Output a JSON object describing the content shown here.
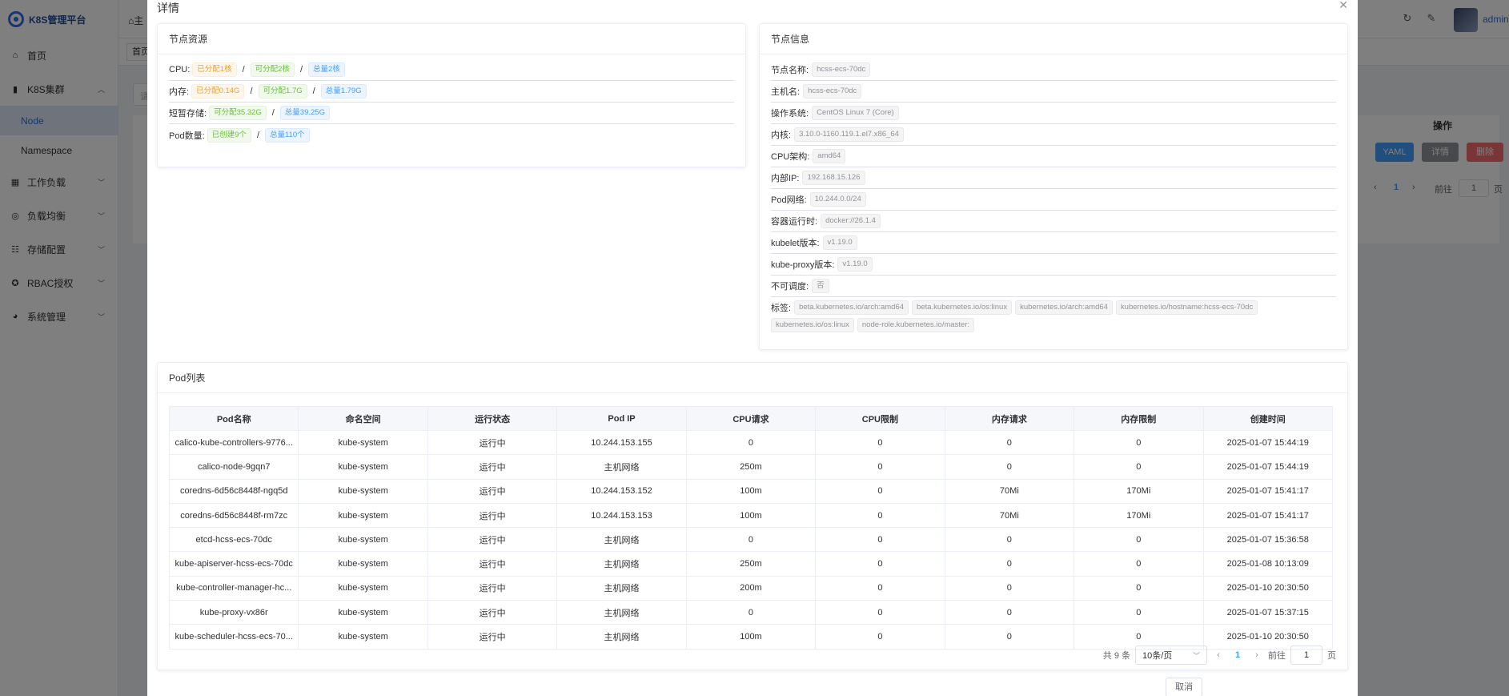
{
  "app": {
    "title": "K8S管理平台",
    "user": "admin"
  },
  "sidebar": {
    "items": [
      {
        "label": "首页",
        "icon": "home-icon"
      },
      {
        "label": "K8S集群",
        "icon": "chart-icon"
      },
      {
        "label": "工作负载",
        "icon": "grid-icon"
      },
      {
        "label": "负载均衡",
        "icon": "balance-icon"
      },
      {
        "label": "存储配置",
        "icon": "list-icon"
      },
      {
        "label": "RBAC授权",
        "icon": "gear-icon"
      },
      {
        "label": "系统管理",
        "icon": "dashboard-icon"
      }
    ],
    "sub_items": [
      {
        "label": "Node"
      },
      {
        "label": "Namespace"
      }
    ]
  },
  "topbar": {
    "breadcrumb": "主",
    "tab_home": "首页"
  },
  "background": {
    "search_placeholder": "请",
    "op_header": "操作",
    "yaml_btn": "YAML",
    "detail_btn": "详情",
    "delete_btn": "删除",
    "pager_current": "1",
    "pager_goto": "前往",
    "pager_input": "1",
    "pager_page": "页"
  },
  "dialog": {
    "title": "详情",
    "resource": {
      "title": "节点资源",
      "cpu_label": "CPU:",
      "cpu_allocated": "已分配1核",
      "cpu_allocatable": "可分配2核",
      "cpu_total": "总量2核",
      "mem_label": "内存:",
      "mem_allocated": "已分配0.14G",
      "mem_allocatable": "可分配1.7G",
      "mem_total": "总量1.79G",
      "storage_label": "短暂存储:",
      "storage_allocatable": "可分配35.32G",
      "storage_total": "总量39.25G",
      "pod_label": "Pod数量:",
      "pod_created": "已创建9个",
      "pod_total": "总量110个",
      "sep": "/"
    },
    "node_info": {
      "title": "节点信息",
      "rows": [
        {
          "label": "节点名称:",
          "value": "hcss-ecs-70dc"
        },
        {
          "label": "主机名:",
          "value": "hcss-ecs-70dc"
        },
        {
          "label": "操作系统:",
          "value": "CentOS Linux 7 (Core)"
        },
        {
          "label": "内核:",
          "value": "3.10.0-1160.119.1.el7.x86_64"
        },
        {
          "label": "CPU架构:",
          "value": "amd64"
        },
        {
          "label": "内部IP:",
          "value": "192.168.15.126"
        },
        {
          "label": "Pod网络:",
          "value": "10.244.0.0/24"
        },
        {
          "label": "容器运行时:",
          "value": "docker://26.1.4"
        },
        {
          "label": "kubelet版本:",
          "value": "v1.19.0"
        },
        {
          "label": "kube-proxy版本:",
          "value": "v1.19.0"
        },
        {
          "label": "不可调度:",
          "value": "否"
        }
      ],
      "labels_label": "标签:",
      "labels": [
        "beta.kubernetes.io/arch:amd64",
        "beta.kubernetes.io/os:linux",
        "kubernetes.io/arch:amd64",
        "kubernetes.io/hostname:hcss-ecs-70dc",
        "kubernetes.io/os:linux",
        "node-role.kubernetes.io/master:"
      ]
    },
    "pods": {
      "title": "Pod列表",
      "columns": [
        "Pod名称",
        "命名空间",
        "运行状态",
        "Pod IP",
        "CPU请求",
        "CPU限制",
        "内存请求",
        "内存限制",
        "创建时间"
      ],
      "rows": [
        [
          "calico-kube-controllers-9776...",
          "kube-system",
          "运行中",
          "10.244.153.155",
          "0",
          "0",
          "0",
          "0",
          "2025-01-07 15:44:19"
        ],
        [
          "calico-node-9gqn7",
          "kube-system",
          "运行中",
          "主机网络",
          "250m",
          "0",
          "0",
          "0",
          "2025-01-07 15:44:19"
        ],
        [
          "coredns-6d56c8448f-ngq5d",
          "kube-system",
          "运行中",
          "10.244.153.152",
          "100m",
          "0",
          "70Mi",
          "170Mi",
          "2025-01-07 15:41:17"
        ],
        [
          "coredns-6d56c8448f-rm7zc",
          "kube-system",
          "运行中",
          "10.244.153.153",
          "100m",
          "0",
          "70Mi",
          "170Mi",
          "2025-01-07 15:41:17"
        ],
        [
          "etcd-hcss-ecs-70dc",
          "kube-system",
          "运行中",
          "主机网络",
          "0",
          "0",
          "0",
          "0",
          "2025-01-07 15:36:58"
        ],
        [
          "kube-apiserver-hcss-ecs-70dc",
          "kube-system",
          "运行中",
          "主机网络",
          "250m",
          "0",
          "0",
          "0",
          "2025-01-08 10:13:09"
        ],
        [
          "kube-controller-manager-hc...",
          "kube-system",
          "运行中",
          "主机网络",
          "200m",
          "0",
          "0",
          "0",
          "2025-01-10 20:30:50"
        ],
        [
          "kube-proxy-vx86r",
          "kube-system",
          "运行中",
          "主机网络",
          "0",
          "0",
          "0",
          "0",
          "2025-01-07 15:37:15"
        ],
        [
          "kube-scheduler-hcss-ecs-70...",
          "kube-system",
          "运行中",
          "主机网络",
          "100m",
          "0",
          "0",
          "0",
          "2025-01-10 20:30:50"
        ]
      ],
      "pager": {
        "total": "共 9 条",
        "page_size": "10条/页",
        "current": "1",
        "goto": "前往",
        "goto_value": "1",
        "page_suffix": "页"
      }
    },
    "cancel": "取消"
  },
  "colors": {
    "primary": "#409eff",
    "success": "#67c23a",
    "warning": "#e6a23c",
    "danger": "#f56c6c"
  }
}
